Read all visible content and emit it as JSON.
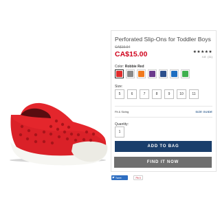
{
  "product": {
    "title": "Perforated Slip-Ons for Toddler Boys",
    "was_price": "CA$19.94",
    "price": "CA$15.00",
    "stars": "★★★★★",
    "rating": "4.8",
    "review_count": "(11)"
  },
  "color": {
    "label": "Color:",
    "selected": "Robbie Red",
    "swatches": [
      {
        "name": "red",
        "hex": "#e02b2b"
      },
      {
        "name": "gray",
        "hex": "#8a8a8a"
      },
      {
        "name": "orange",
        "hex": "#f07a1e"
      },
      {
        "name": "purple",
        "hex": "#6b3a8c"
      },
      {
        "name": "navy",
        "hex": "#2c4f8c"
      },
      {
        "name": "blue",
        "hex": "#1f6fc1"
      },
      {
        "name": "green",
        "hex": "#3fb04f"
      }
    ]
  },
  "size": {
    "label": "Size:",
    "options": [
      "5",
      "6",
      "7",
      "8",
      "9",
      "10",
      "11"
    ]
  },
  "fit": {
    "label": "Fit & Sizing",
    "guide_link": "SIZE GUIDE"
  },
  "quantity": {
    "label": "Quantity:",
    "value": "1"
  },
  "buttons": {
    "add_to_bag": "ADD TO BAG",
    "find_it_now": "FIND IT NOW"
  },
  "social": {
    "tweet": "Tweet",
    "pin": "Pin it"
  },
  "colors": {
    "price_red": "#d0021b",
    "button_navy": "#1a3e6b",
    "button_gray": "#6f6f6f",
    "link_blue": "#2c5a8c"
  }
}
